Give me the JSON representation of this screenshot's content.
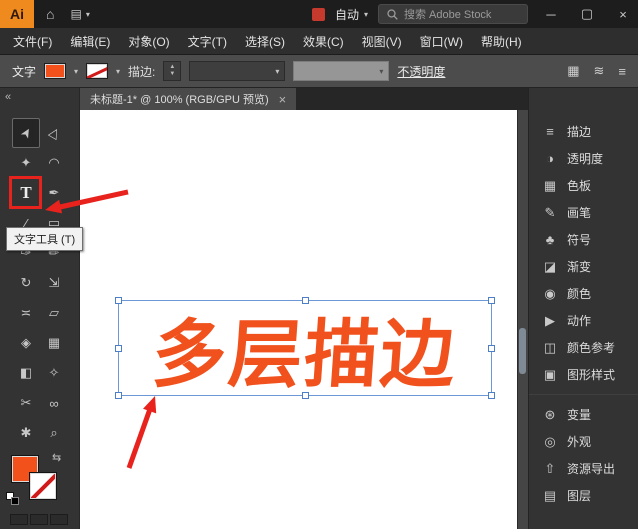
{
  "titlebar": {
    "logo": "Ai",
    "home_glyph": "⌂",
    "workspace_glyph": "▤",
    "auto_label": "自动",
    "search_text": "搜索 Adobe Stock",
    "minimize_glyph": "─",
    "maximize_glyph": "▢",
    "close_glyph": "×"
  },
  "menubar": {
    "items": [
      "文件(F)",
      "编辑(E)",
      "对象(O)",
      "文字(T)",
      "选择(S)",
      "效果(C)",
      "视图(V)",
      "窗口(W)",
      "帮助(H)"
    ]
  },
  "controlbar": {
    "context_label": "文字",
    "stroke_label": "描边:",
    "opacity_label": "不透明度",
    "fill_color": "#f2511b",
    "stroke_color": "none",
    "icons": {
      "grid": "▦",
      "flow": "≋",
      "menu": "≡"
    }
  },
  "ui": {
    "caret": "▾",
    "spin_up": "▲",
    "spin_down": "▼"
  },
  "tabbar": {
    "title": "未标题-1* @ 100% (RGB/GPU 预览)",
    "close_glyph": "×"
  },
  "toolbar": {
    "collapse_glyph": "«",
    "swap_glyph": "⇆",
    "tools": [
      {
        "name": "selection",
        "glyph": "➤"
      },
      {
        "name": "direct-selection",
        "glyph": "▷"
      },
      {
        "name": "magic-wand",
        "glyph": "✦"
      },
      {
        "name": "lasso",
        "glyph": "◠"
      },
      {
        "name": "type",
        "glyph": "T"
      },
      {
        "name": "pen",
        "glyph": "✒"
      },
      {
        "name": "line-segment",
        "glyph": "∕"
      },
      {
        "name": "rectangle",
        "glyph": "▭"
      },
      {
        "name": "paintbrush",
        "glyph": "✑"
      },
      {
        "name": "pencil",
        "glyph": "✏"
      },
      {
        "name": "rotate",
        "glyph": "↻"
      },
      {
        "name": "scale",
        "glyph": "⇲"
      },
      {
        "name": "width",
        "glyph": "≍"
      },
      {
        "name": "free-transform",
        "glyph": "▱"
      },
      {
        "name": "shape-builder",
        "glyph": "◈"
      },
      {
        "name": "mesh",
        "glyph": "▦"
      },
      {
        "name": "gradient",
        "glyph": "◧"
      },
      {
        "name": "eyedropper",
        "glyph": "✧"
      },
      {
        "name": "scissors",
        "glyph": "✂"
      },
      {
        "name": "blend",
        "glyph": "∞"
      },
      {
        "name": "hand",
        "glyph": "✱"
      },
      {
        "name": "zoom",
        "glyph": "⌕"
      }
    ]
  },
  "tooltip": {
    "text": "文字工具 (T)"
  },
  "canvas": {
    "artwork_text": "多层描边",
    "text_color": "#f1511d",
    "annotation_color": "#e8231d"
  },
  "panel": {
    "items": [
      {
        "label": "描边",
        "glyph": "≡"
      },
      {
        "label": "透明度",
        "glyph": "◑"
      },
      {
        "label": "色板",
        "glyph": "▦"
      },
      {
        "label": "画笔",
        "glyph": "✎"
      },
      {
        "label": "符号",
        "glyph": "♣"
      },
      {
        "label": "渐变",
        "glyph": "◪"
      },
      {
        "label": "颜色",
        "glyph": "◉"
      },
      {
        "label": "动作",
        "glyph": "▶"
      },
      {
        "label": "颜色参考",
        "glyph": "◫"
      },
      {
        "label": "图形样式",
        "glyph": "▣"
      },
      {
        "label": "变量",
        "glyph": "⊛"
      },
      {
        "label": "外观",
        "glyph": "◎"
      },
      {
        "label": "资源导出",
        "glyph": "⇧"
      },
      {
        "label": "图层",
        "glyph": "▤"
      }
    ]
  }
}
